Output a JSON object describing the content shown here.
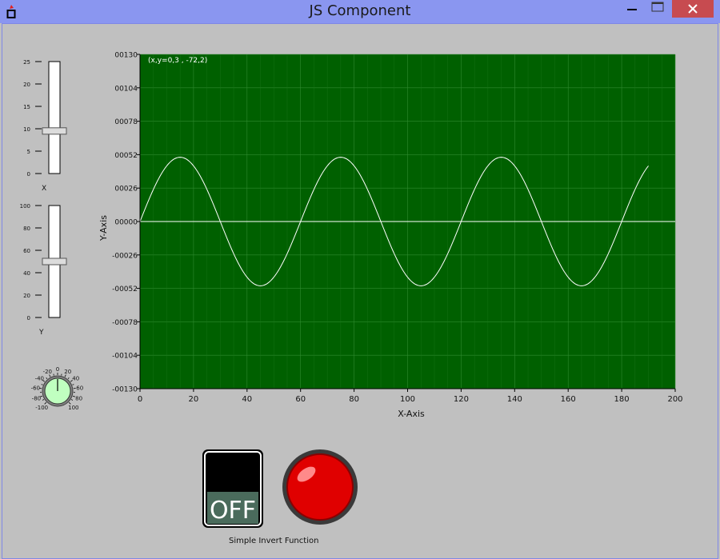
{
  "window": {
    "title": "JS Component",
    "icon": "app-flame-icon",
    "controls": [
      "minimize-icon",
      "maximize-icon",
      "close-icon"
    ],
    "close_color": "#c74b50",
    "titlebar_color": "#8a96f0"
  },
  "slider_x": {
    "label": "X",
    "ticks": [
      "25",
      "20",
      "15",
      "10",
      "5",
      "0"
    ],
    "min": 0,
    "max": 25,
    "value": 9.5
  },
  "slider_y": {
    "label": "Y",
    "ticks": [
      "100",
      "80",
      "60",
      "40",
      "20",
      "0"
    ],
    "min": 0,
    "max": 100,
    "value": 50
  },
  "knob": {
    "labels": [
      "-100",
      "-80",
      "-60",
      "-40",
      "-20",
      "0",
      "20",
      "40",
      "60",
      "80",
      "100"
    ],
    "min": -100,
    "max": 100,
    "value": 0,
    "fill_color": "#c0ffc0"
  },
  "chart_data": {
    "type": "line",
    "title": "",
    "xlabel": "X-Axis",
    "ylabel": "Y-Axis",
    "cursor_readout": "(x,y=0,3 , -72,2)",
    "xlim": [
      0,
      200
    ],
    "ylim": [
      -130,
      130
    ],
    "x_ticks": [
      "0",
      "20",
      "40",
      "60",
      "80",
      "100",
      "120",
      "140",
      "160",
      "180",
      "200"
    ],
    "y_ticks": [
      "00130",
      "00104",
      "00078",
      "00052",
      "00026",
      "00000",
      "-00026",
      "-00052",
      "-00078",
      "-00104",
      "-00130"
    ],
    "grid": true,
    "background": "#006000",
    "series": [
      {
        "function": "y = 50 * sin(2*pi*x/60)",
        "amplitude": 50,
        "period": 60,
        "x_start": 0,
        "x_end": 190,
        "color": "#ffffff"
      },
      {
        "function": "y = 0",
        "value": 0,
        "color": "#ffffff"
      }
    ]
  },
  "switch": {
    "state_label": "OFF",
    "caption": "Simple Invert Function"
  },
  "indicator_light": {
    "color": "#e00000",
    "state": "on"
  }
}
